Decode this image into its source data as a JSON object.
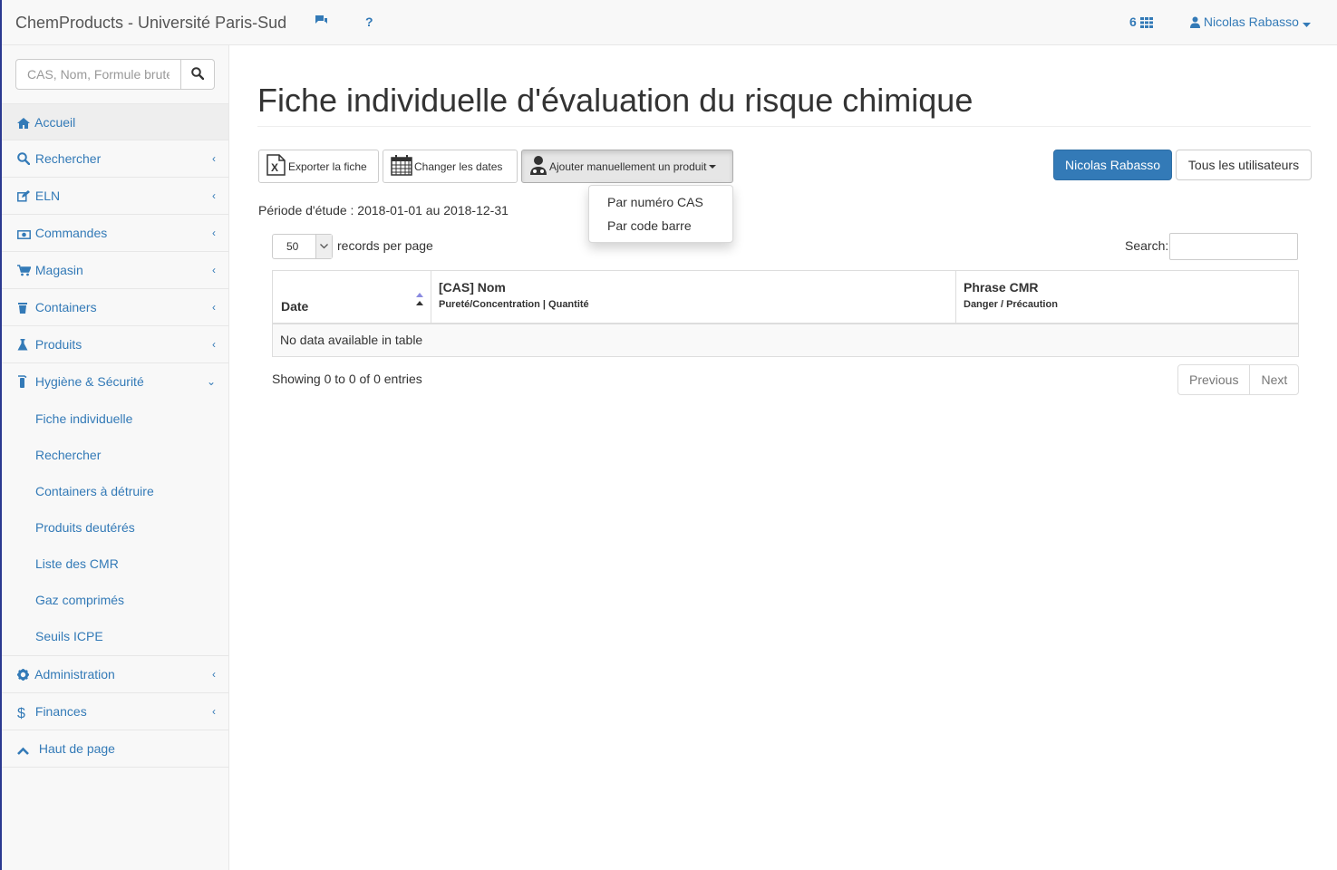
{
  "navbar": {
    "brand": "ChemProducts - Université Paris-Sud",
    "chat_icon": "comments-icon",
    "help_label": "?",
    "count": "6",
    "user_name": "Nicolas Rabasso"
  },
  "sidebar": {
    "search_placeholder": "CAS, Nom, Formule brute",
    "items": [
      {
        "label": "Accueil",
        "icon": "home-icon"
      },
      {
        "label": "Rechercher",
        "icon": "search-icon"
      },
      {
        "label": "ELN",
        "icon": "edit-icon"
      },
      {
        "label": "Commandes",
        "icon": "money-icon"
      },
      {
        "label": "Magasin",
        "icon": "cart-icon"
      },
      {
        "label": "Containers",
        "icon": "trash-icon"
      },
      {
        "label": "Produits",
        "icon": "flask-icon"
      },
      {
        "label": "Hygiène & Sécurité",
        "icon": "extinguisher-icon"
      }
    ],
    "submenu": [
      "Fiche individuelle",
      "Rechercher",
      "Containers à détruire",
      "Produits deutérés",
      "Liste des CMR",
      "Gaz comprimés",
      "Seuils ICPE"
    ],
    "bottom_items": [
      {
        "label": "Administration",
        "icon": "cog-icon"
      },
      {
        "label": "Finances",
        "icon": "dollar-icon"
      },
      {
        "label": "Haut de page",
        "icon": "chevron-up-icon"
      }
    ]
  },
  "main": {
    "title": "Fiche individuelle d'évaluation du risque chimique",
    "toolbar": {
      "export_label": "Exporter la fiche",
      "dates_label": "Changer les dates",
      "add_label": "Ajouter manuellement un produit"
    },
    "dropdown": [
      "Par numéro CAS",
      "Par code barre"
    ],
    "user_buttons": {
      "current": "Nicolas Rabasso",
      "all": "Tous les utilisateurs"
    },
    "period": "Période d'étude : 2018-01-01 au 2018-12-31",
    "length_value": "50",
    "records_label": "records per page",
    "search_label": "Search:",
    "table": {
      "col1": "Date",
      "col2": "[CAS] Nom",
      "col2_sub": "Pureté/Concentration | Quantité",
      "col3": "Phrase CMR",
      "col3_sub": "Danger / Précaution",
      "empty": "No data available in table"
    },
    "info": "Showing 0 to 0 of 0 entries",
    "pager": {
      "previous": "Previous",
      "next": "Next"
    }
  },
  "colors": {
    "primary": "#337ab7",
    "navbar_bg": "#f8f8f8",
    "border": "#ddd"
  }
}
